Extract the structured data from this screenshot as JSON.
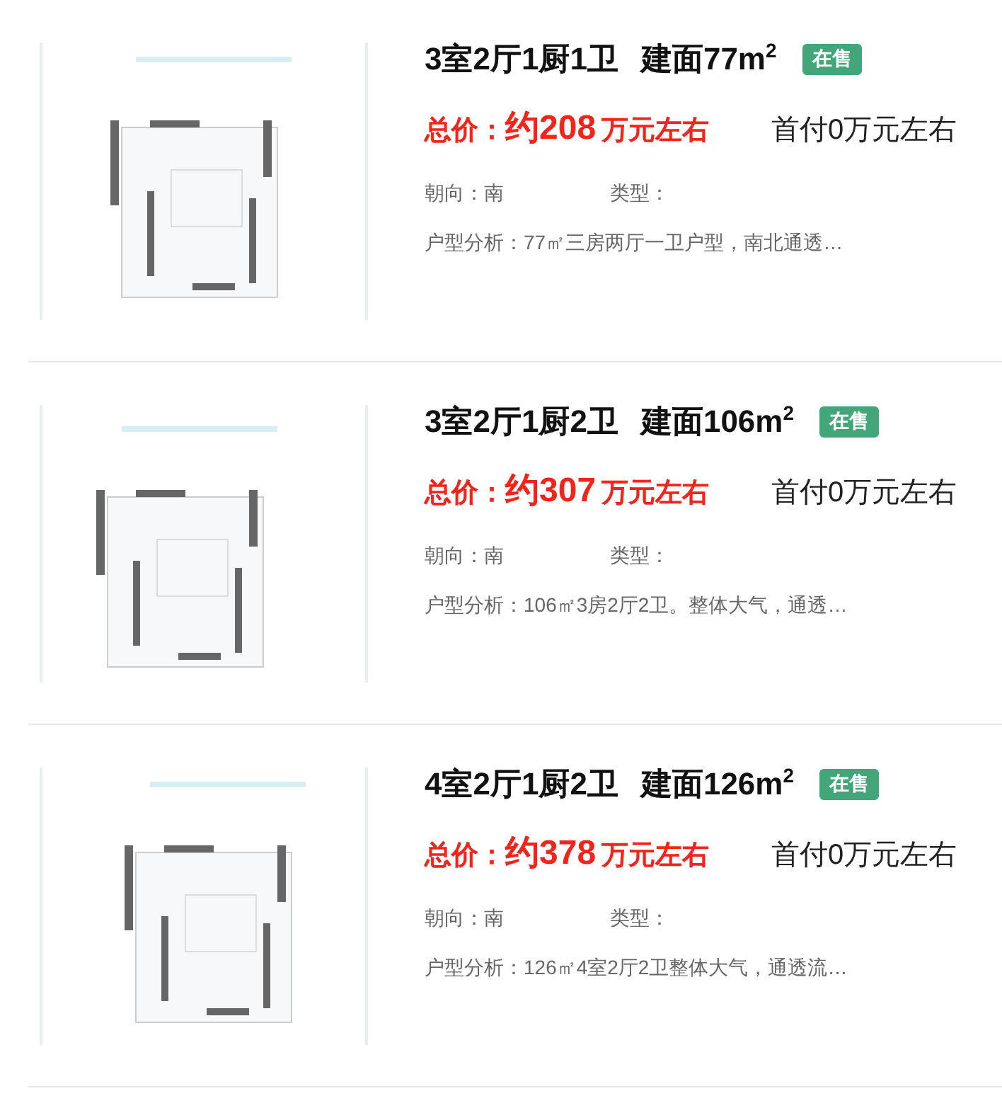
{
  "listings": [
    {
      "layout": "3室2厅1厨1卫",
      "area": "建面77m$^{2}$",
      "status": "在售",
      "price_label": "总价：",
      "price": "约208",
      "price_unit": "万元左右",
      "down_payment": "首付0万元左右",
      "orientation": "朝向：南",
      "type": "类型：",
      "analysis": "户型分析：77㎡三房两厅一卫户型，南北通透…"
    },
    {
      "layout": "3室2厅1厨2卫",
      "area": "建面106m$^{2}$",
      "status": "在售",
      "price_label": "总价：",
      "price": "约307",
      "price_unit": "万元左右",
      "down_payment": "首付0万元左右",
      "orientation": "朝向：南",
      "type": "类型：",
      "analysis": "户型分析：106㎡3房2厅2卫。整体大气，通透…"
    },
    {
      "layout": "4室2厅1厨2卫",
      "area": "建面126m$^{2}$",
      "status": "在售",
      "price_label": "总价：",
      "price": "约378",
      "price_unit": "万元左右",
      "down_payment": "首付0万元左右",
      "orientation": "朝向：南",
      "type": "类型：",
      "analysis": "户型分析：126㎡4室2厅2卫整体大气，通透流…"
    }
  ]
}
